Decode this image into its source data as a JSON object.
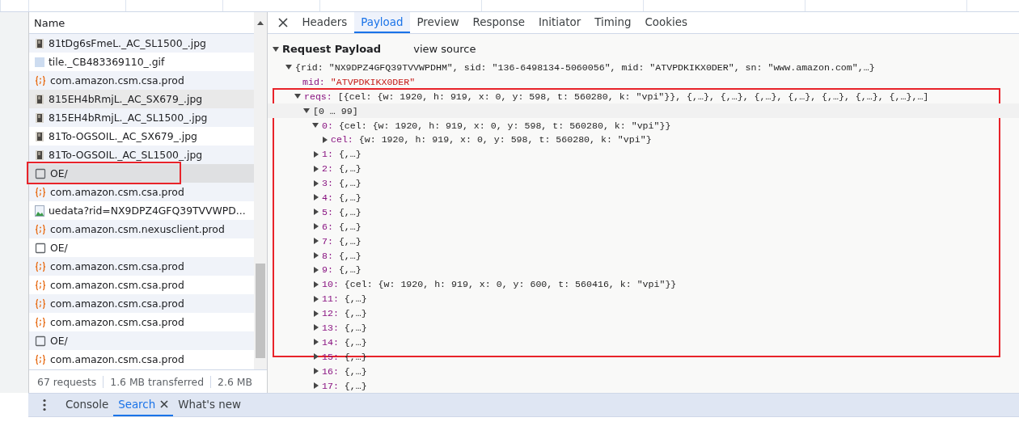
{
  "requests": {
    "column_header": "Name",
    "rows": [
      {
        "name": "81tDg6sFmeL._AC_SL1500_.jpg",
        "kind": "photo",
        "selected": false,
        "hovered": false,
        "annotated": false
      },
      {
        "name": "tile._CB483369110_.gif",
        "kind": "gif",
        "selected": false,
        "hovered": false,
        "annotated": false
      },
      {
        "name": "com.amazon.csm.csa.prod",
        "kind": "script",
        "selected": false,
        "hovered": false,
        "annotated": false
      },
      {
        "name": "815EH4bRmjL._AC_SX679_.jpg",
        "kind": "photo",
        "selected": false,
        "hovered": true,
        "annotated": false
      },
      {
        "name": "815EH4bRmjL._AC_SL1500_.jpg",
        "kind": "photo",
        "selected": false,
        "hovered": false,
        "annotated": false
      },
      {
        "name": "81To-OGSOIL._AC_SX679_.jpg",
        "kind": "photo",
        "selected": false,
        "hovered": false,
        "annotated": false
      },
      {
        "name": "81To-OGSOIL._AC_SL1500_.jpg",
        "kind": "photo",
        "selected": false,
        "hovered": false,
        "annotated": false
      },
      {
        "name": "OE/",
        "kind": "document",
        "selected": true,
        "hovered": false,
        "annotated": true
      },
      {
        "name": "com.amazon.csm.csa.prod",
        "kind": "script",
        "selected": false,
        "hovered": false,
        "annotated": false
      },
      {
        "name": "uedata?rid=NX9DPZ4GFQ39TVVWPD...",
        "kind": "image",
        "selected": false,
        "hovered": false,
        "annotated": false
      },
      {
        "name": "com.amazon.csm.nexusclient.prod",
        "kind": "script",
        "selected": false,
        "hovered": false,
        "annotated": false
      },
      {
        "name": "OE/",
        "kind": "document",
        "selected": false,
        "hovered": false,
        "annotated": false
      },
      {
        "name": "com.amazon.csm.csa.prod",
        "kind": "script",
        "selected": false,
        "hovered": false,
        "annotated": false
      },
      {
        "name": "com.amazon.csm.csa.prod",
        "kind": "script",
        "selected": false,
        "hovered": false,
        "annotated": false
      },
      {
        "name": "com.amazon.csm.csa.prod",
        "kind": "script",
        "selected": false,
        "hovered": false,
        "annotated": false
      },
      {
        "name": "com.amazon.csm.csa.prod",
        "kind": "script",
        "selected": false,
        "hovered": false,
        "annotated": false
      },
      {
        "name": "OE/",
        "kind": "document",
        "selected": false,
        "hovered": false,
        "annotated": false
      },
      {
        "name": "com.amazon.csm.csa.prod",
        "kind": "script",
        "selected": false,
        "hovered": false,
        "annotated": false
      }
    ],
    "status_bar": [
      "67 requests",
      "1.6 MB transferred",
      "2.6 MB"
    ]
  },
  "detail": {
    "tabs": [
      {
        "label": "Headers",
        "selected": false
      },
      {
        "label": "Payload",
        "selected": true
      },
      {
        "label": "Preview",
        "selected": false
      },
      {
        "label": "Response",
        "selected": false
      },
      {
        "label": "Initiator",
        "selected": false
      },
      {
        "label": "Timing",
        "selected": false
      },
      {
        "label": "Cookies",
        "selected": false
      }
    ],
    "section": {
      "title": "Request Payload",
      "action": "view source",
      "expanded": true
    },
    "tree": [
      {
        "kind": "root",
        "value": "{rid: \"NX9DPZ4GFQ39TVVWPDHM\", sid: \"136-6498134-5060056\", mid: \"ATVPDKIKX0DER\", sn: \"www.amazon.com\",…}",
        "expanded": true,
        "children": [
          {
            "kind": "string",
            "key": "mid:",
            "value": "\"ATVPDKIKX0DER\""
          },
          {
            "kind": "object",
            "key": "reqs:",
            "value": "[{cel: {w: 1920, h: 919, x: 0, y: 598, t: 560280, k: \"vpi\"}}, {,…}, {,…}, {,…}, {,…}, {,…}, {,…}, {,…},…]",
            "expanded": true,
            "annotated": true,
            "children": [
              {
                "kind": "range",
                "value": "[0 … 99]",
                "expanded": true,
                "children": [
                  {
                    "kind": "object",
                    "key": "0:",
                    "value": "{cel: {w: 1920, h: 919, x: 0, y: 598, t: 560280, k: \"vpi\"}}",
                    "expanded": true,
                    "children": [
                      {
                        "kind": "object",
                        "key": "cel:",
                        "value": "{w: 1920, h: 919, x: 0, y: 598, t: 560280, k: \"vpi\"}",
                        "expanded": false
                      }
                    ]
                  },
                  {
                    "kind": "object",
                    "key": "1:",
                    "value": "{,…}",
                    "expanded": false
                  },
                  {
                    "kind": "object",
                    "key": "2:",
                    "value": "{,…}",
                    "expanded": false
                  },
                  {
                    "kind": "object",
                    "key": "3:",
                    "value": "{,…}",
                    "expanded": false
                  },
                  {
                    "kind": "object",
                    "key": "4:",
                    "value": "{,…}",
                    "expanded": false
                  },
                  {
                    "kind": "object",
                    "key": "5:",
                    "value": "{,…}",
                    "expanded": false
                  },
                  {
                    "kind": "object",
                    "key": "6:",
                    "value": "{,…}",
                    "expanded": false
                  },
                  {
                    "kind": "object",
                    "key": "7:",
                    "value": "{,…}",
                    "expanded": false
                  },
                  {
                    "kind": "object",
                    "key": "8:",
                    "value": "{,…}",
                    "expanded": false
                  },
                  {
                    "kind": "object",
                    "key": "9:",
                    "value": "{,…}",
                    "expanded": false
                  },
                  {
                    "kind": "object",
                    "key": "10:",
                    "value": "{cel: {w: 1920, h: 919, x: 0, y: 600, t: 560416, k: \"vpi\"}}",
                    "expanded": false
                  },
                  {
                    "kind": "object",
                    "key": "11:",
                    "value": "{,…}",
                    "expanded": false
                  },
                  {
                    "kind": "object",
                    "key": "12:",
                    "value": "{,…}",
                    "expanded": false
                  },
                  {
                    "kind": "object",
                    "key": "13:",
                    "value": "{,…}",
                    "expanded": false
                  },
                  {
                    "kind": "object",
                    "key": "14:",
                    "value": "{,…}",
                    "expanded": false
                  },
                  {
                    "kind": "object",
                    "key": "15:",
                    "value": "{,…}",
                    "expanded": false
                  },
                  {
                    "kind": "object",
                    "key": "16:",
                    "value": "{,…}",
                    "expanded": false
                  },
                  {
                    "kind": "object",
                    "key": "17:",
                    "value": "{,…}",
                    "expanded": false
                  }
                ]
              }
            ]
          }
        ]
      }
    ]
  },
  "drawer": {
    "tabs": [
      {
        "label": "Console",
        "selected": false,
        "closable": false
      },
      {
        "label": "Search",
        "selected": true,
        "closable": true
      },
      {
        "label": "What's new",
        "selected": false,
        "closable": false
      }
    ]
  }
}
